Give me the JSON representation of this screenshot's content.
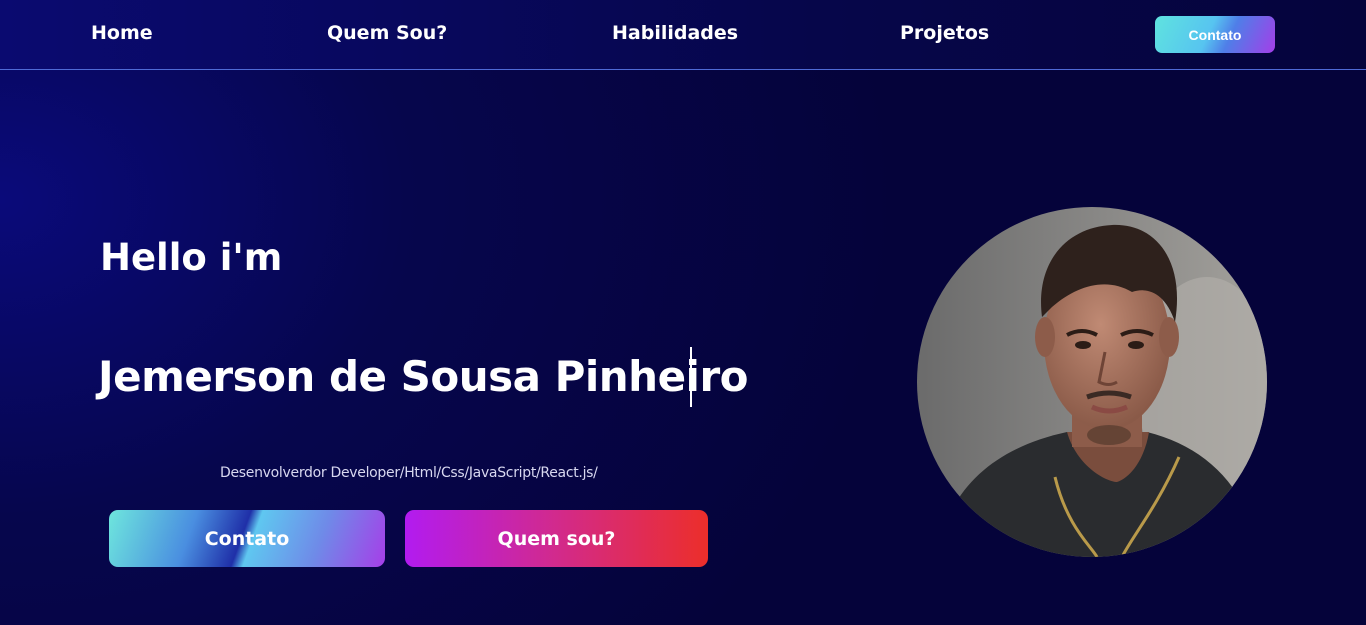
{
  "nav": {
    "items": [
      {
        "label": "Home"
      },
      {
        "label": "Quem Sou?"
      },
      {
        "label": "Habilidades"
      },
      {
        "label": "Projetos"
      }
    ],
    "contact_label": "Contato"
  },
  "hero": {
    "greeting": "Hello i'm",
    "name": "Jemerson de Sousa Pinheiro",
    "tagline": "Desenvolverdor Developer/Html/Css/JavaScript/React.js/",
    "buttons": {
      "contact_label": "Contato",
      "about_label": "Quem sou?"
    }
  },
  "colors": {
    "background": "#06064d",
    "nav_border": "#4f6ad6",
    "contact_gradient_start": "#5fe3df",
    "contact_gradient_end": "#a43ee8",
    "about_gradient_start": "#b21bf0",
    "about_gradient_end": "#ec2e2a"
  }
}
